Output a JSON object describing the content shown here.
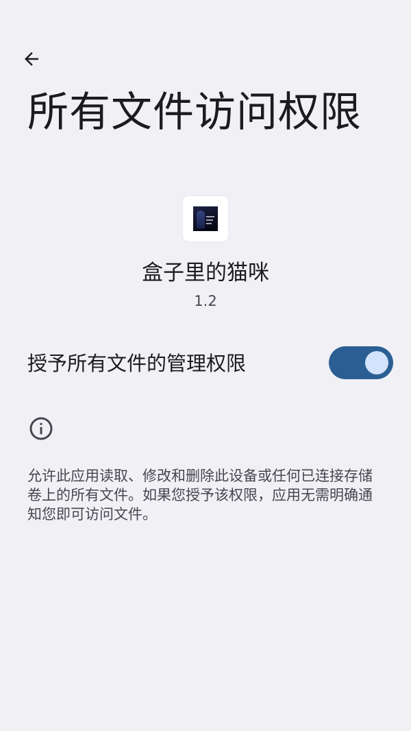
{
  "header": {
    "title": "所有文件访问权限",
    "back_icon": "arrow-left-icon"
  },
  "app": {
    "name": "盒子里的猫咪",
    "version": "1.2"
  },
  "permission": {
    "label": "授予所有文件的管理权限",
    "enabled": true
  },
  "info": {
    "icon": "info-icon",
    "description": "允许此应用读取、修改和删除此设备或任何已连接存储卷上的所有文件。如果您授予该权限，应用无需明确通知您即可访问文件。"
  },
  "colors": {
    "background": "#f1f0f5",
    "switch_track": "#2b5f93",
    "switch_thumb": "#d3e3fd"
  }
}
